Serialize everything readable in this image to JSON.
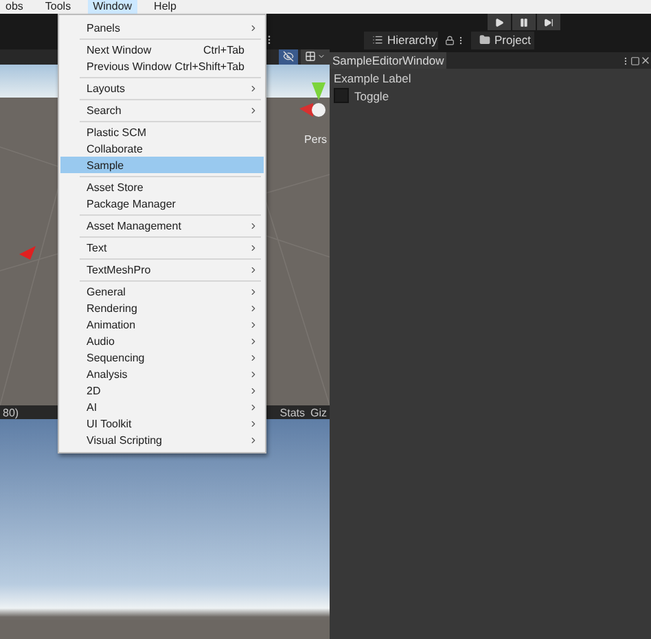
{
  "menu_bar": [
    {
      "label": "obs",
      "selected": false
    },
    {
      "label": "Tools",
      "selected": false
    },
    {
      "label": "Window",
      "selected": true
    },
    {
      "label": "Help",
      "selected": false
    }
  ],
  "menu": {
    "groups": [
      [
        {
          "label": "Panels",
          "submenu": true,
          "selected": false
        }
      ],
      [
        {
          "label": "Next Window",
          "shortcut": "Ctrl+Tab",
          "submenu": false,
          "selected": false
        },
        {
          "label": "Previous Window",
          "shortcut": "Ctrl+Shift+Tab",
          "submenu": false,
          "selected": false
        }
      ],
      [
        {
          "label": "Layouts",
          "submenu": true,
          "selected": false
        }
      ],
      [
        {
          "label": "Search",
          "submenu": true,
          "selected": false
        }
      ],
      [
        {
          "label": "Plastic SCM",
          "submenu": false,
          "selected": false
        },
        {
          "label": "Collaborate",
          "submenu": false,
          "selected": false
        },
        {
          "label": "Sample",
          "submenu": false,
          "selected": true
        }
      ],
      [
        {
          "label": "Asset Store",
          "submenu": false,
          "selected": false
        },
        {
          "label": "Package Manager",
          "submenu": false,
          "selected": false
        }
      ],
      [
        {
          "label": "Asset Management",
          "submenu": true,
          "selected": false
        }
      ],
      [
        {
          "label": "Text",
          "submenu": true,
          "selected": false
        }
      ],
      [
        {
          "label": "TextMeshPro",
          "submenu": true,
          "selected": false
        }
      ],
      [
        {
          "label": "General",
          "submenu": true,
          "selected": false
        },
        {
          "label": "Rendering",
          "submenu": true,
          "selected": false
        },
        {
          "label": "Animation",
          "submenu": true,
          "selected": false
        },
        {
          "label": "Audio",
          "submenu": true,
          "selected": false
        },
        {
          "label": "Sequencing",
          "submenu": true,
          "selected": false
        },
        {
          "label": "Analysis",
          "submenu": true,
          "selected": false
        },
        {
          "label": "2D",
          "submenu": true,
          "selected": false
        },
        {
          "label": "AI",
          "submenu": true,
          "selected": false
        },
        {
          "label": "UI Toolkit",
          "submenu": true,
          "selected": false
        },
        {
          "label": "Visual Scripting",
          "submenu": true,
          "selected": false
        }
      ]
    ]
  },
  "scene_view": {
    "camera_label": "Pers"
  },
  "game_toolbar": {
    "resolution": "80)",
    "stats": "Stats",
    "gizmos": "Giz"
  },
  "tabs": [
    {
      "label": "Hierarchy",
      "kind": "hierarchy"
    },
    {
      "label": "Project",
      "kind": "project"
    }
  ],
  "editor_window": {
    "title": "SampleEditorWindow",
    "label": "Example Label",
    "toggle": {
      "label": "Toggle",
      "checked": false
    }
  }
}
